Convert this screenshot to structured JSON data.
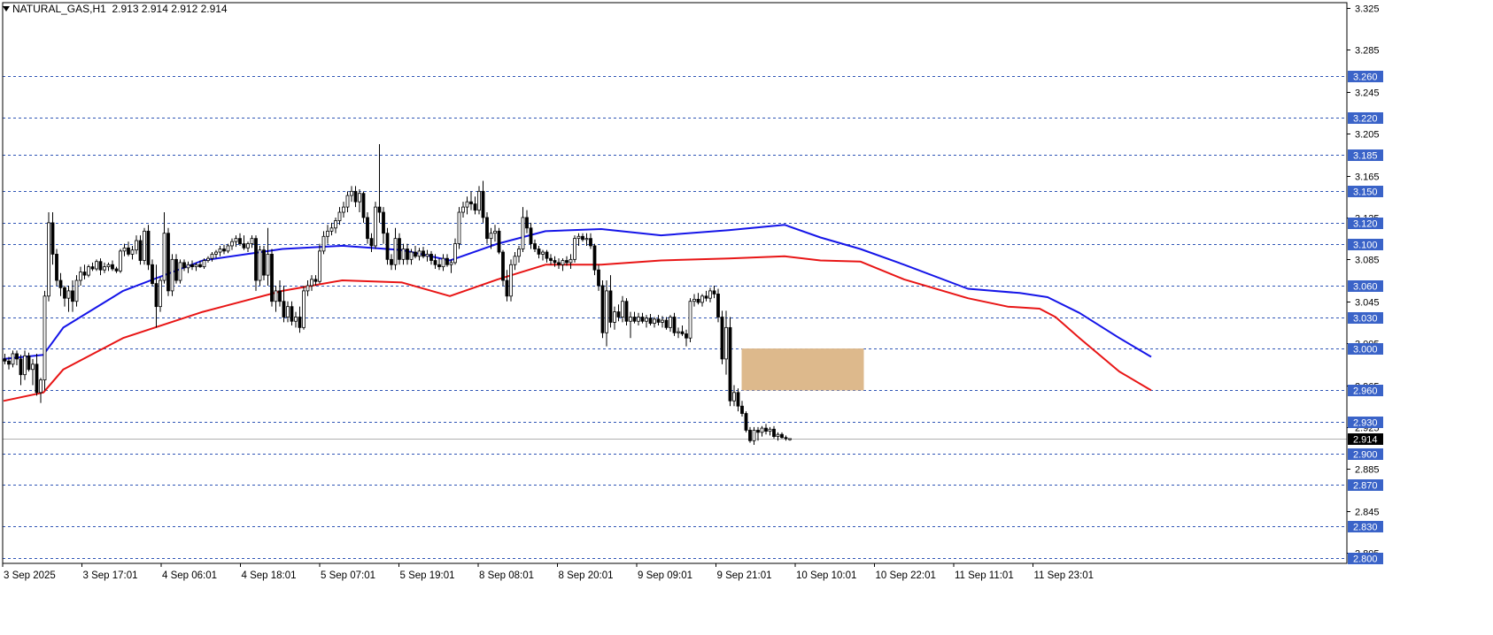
{
  "header": {
    "symbol": "NATURAL_GAS,H1",
    "ohlc": "2.913 2.914 2.912 2.914"
  },
  "colors": {
    "background": "#ffffff",
    "level_line": "#2f55b5",
    "level_label_bg": "#3a63c8",
    "ma_fast": "#1515e8",
    "ma_slow": "#e81515",
    "zone": "#ddb98c",
    "price_label_bg": "#000000",
    "candle_bull": "#ffffff",
    "candle_bear": "#000000"
  },
  "chart_data": {
    "type": "candlestick",
    "timeframe": "H1",
    "y_range": [
      2.795,
      3.327
    ],
    "y_axis_ticks": [
      3.325,
      3.285,
      3.245,
      3.205,
      3.165,
      3.125,
      3.085,
      3.045,
      3.005,
      2.965,
      2.925,
      2.885,
      2.845,
      2.805
    ],
    "x_axis_labels": [
      "3 Sep 2025",
      "3 Sep 17:01",
      "4 Sep 06:01",
      "4 Sep 18:01",
      "5 Sep 07:01",
      "5 Sep 19:01",
      "8 Sep 08:01",
      "8 Sep 20:01",
      "9 Sep 09:01",
      "9 Sep 21:01",
      "10 Sep 10:01",
      "10 Sep 22:01",
      "11 Sep 11:01",
      "11 Sep 23:01"
    ],
    "level_lines": [
      "3.260",
      "3.220",
      "3.185",
      "3.150",
      "3.120",
      "3.100",
      "3.060",
      "3.030",
      "3.000",
      "2.960",
      "2.930",
      "2.900",
      "2.870",
      "2.830",
      "2.800"
    ],
    "current_price": "2.914",
    "zone": {
      "bar_start": 185,
      "bar_end": 215,
      "price_low": 2.96,
      "price_high": 3.0
    },
    "candles": [
      [
        2.99,
        2.995,
        2.985,
        2.988
      ],
      [
        2.988,
        2.992,
        2.98,
        2.985
      ],
      [
        2.985,
        2.998,
        2.982,
        2.995
      ],
      [
        2.995,
        2.998,
        2.984,
        2.99
      ],
      [
        2.99,
        2.994,
        2.965,
        2.975
      ],
      [
        2.975,
        2.998,
        2.97,
        2.993
      ],
      [
        2.993,
        2.996,
        2.978,
        2.98
      ],
      [
        2.98,
        2.99,
        2.965,
        2.985
      ],
      [
        2.985,
        2.995,
        2.955,
        2.958
      ],
      [
        2.958,
        2.972,
        2.948,
        2.97
      ],
      [
        2.97,
        3.055,
        2.96,
        3.05
      ],
      [
        3.05,
        3.13,
        3.045,
        3.12
      ],
      [
        3.12,
        3.13,
        3.08,
        3.09
      ],
      [
        3.09,
        3.095,
        3.06,
        3.065
      ],
      [
        3.065,
        3.072,
        3.05,
        3.058
      ],
      [
        3.058,
        3.06,
        3.04,
        3.048
      ],
      [
        3.048,
        3.06,
        3.035,
        3.055
      ],
      [
        3.055,
        3.065,
        3.035,
        3.045
      ],
      [
        3.045,
        3.07,
        3.04,
        3.065
      ],
      [
        3.065,
        3.078,
        3.06,
        3.073
      ],
      [
        3.073,
        3.08,
        3.066,
        3.07
      ],
      [
        3.07,
        3.08,
        3.068,
        3.078
      ],
      [
        3.078,
        3.082,
        3.074,
        3.076
      ],
      [
        3.076,
        3.085,
        3.074,
        3.083
      ],
      [
        3.083,
        3.086,
        3.07,
        3.075
      ],
      [
        3.075,
        3.082,
        3.072,
        3.078
      ],
      [
        3.078,
        3.082,
        3.074,
        3.08
      ],
      [
        3.08,
        3.084,
        3.074,
        3.076
      ],
      [
        3.076,
        3.078,
        3.072,
        3.074
      ],
      [
        3.074,
        3.095,
        3.072,
        3.093
      ],
      [
        3.093,
        3.1,
        3.088,
        3.096
      ],
      [
        3.096,
        3.102,
        3.088,
        3.09
      ],
      [
        3.09,
        3.098,
        3.085,
        3.094
      ],
      [
        3.094,
        3.108,
        3.09,
        3.103
      ],
      [
        3.103,
        3.108,
        3.08,
        3.084
      ],
      [
        3.084,
        3.115,
        3.08,
        3.112
      ],
      [
        3.112,
        3.118,
        3.075,
        3.08
      ],
      [
        3.08,
        3.085,
        3.06,
        3.062
      ],
      [
        3.062,
        3.08,
        3.02,
        3.04
      ],
      [
        3.04,
        3.068,
        3.035,
        3.065
      ],
      [
        3.065,
        3.13,
        3.062,
        3.11
      ],
      [
        3.11,
        3.115,
        3.05,
        3.055
      ],
      [
        3.055,
        3.09,
        3.05,
        3.085
      ],
      [
        3.085,
        3.09,
        3.062,
        3.065
      ],
      [
        3.065,
        3.085,
        3.062,
        3.082
      ],
      [
        3.082,
        3.085,
        3.074,
        3.077
      ],
      [
        3.077,
        3.083,
        3.072,
        3.08
      ],
      [
        3.08,
        3.084,
        3.075,
        3.078
      ],
      [
        3.078,
        3.082,
        3.074,
        3.08
      ],
      [
        3.08,
        3.084,
        3.077,
        3.078
      ],
      [
        3.078,
        3.086,
        3.076,
        3.084
      ],
      [
        3.084,
        3.088,
        3.082,
        3.086
      ],
      [
        3.086,
        3.092,
        3.083,
        3.09
      ],
      [
        3.09,
        3.094,
        3.086,
        3.092
      ],
      [
        3.092,
        3.098,
        3.088,
        3.095
      ],
      [
        3.095,
        3.099,
        3.09,
        3.093
      ],
      [
        3.093,
        3.1,
        3.091,
        3.098
      ],
      [
        3.098,
        3.105,
        3.094,
        3.102
      ],
      [
        3.102,
        3.108,
        3.097,
        3.105
      ],
      [
        3.105,
        3.11,
        3.098,
        3.1
      ],
      [
        3.1,
        3.108,
        3.094,
        3.096
      ],
      [
        3.096,
        3.102,
        3.092,
        3.1
      ],
      [
        3.1,
        3.108,
        3.096,
        3.105
      ],
      [
        3.105,
        3.108,
        3.055,
        3.065
      ],
      [
        3.065,
        3.098,
        3.06,
        3.094
      ],
      [
        3.094,
        3.098,
        3.065,
        3.07
      ],
      [
        3.07,
        3.115,
        3.06,
        3.09
      ],
      [
        3.09,
        3.095,
        3.04,
        3.045
      ],
      [
        3.045,
        3.06,
        3.035,
        3.055
      ],
      [
        3.055,
        3.065,
        3.04,
        3.045
      ],
      [
        3.045,
        3.06,
        3.025,
        3.03
      ],
      [
        3.03,
        3.045,
        3.025,
        3.04
      ],
      [
        3.04,
        3.045,
        3.022,
        3.026
      ],
      [
        3.026,
        3.035,
        3.02,
        3.03
      ],
      [
        3.03,
        3.04,
        3.015,
        3.02
      ],
      [
        3.02,
        3.06,
        3.018,
        3.055
      ],
      [
        3.055,
        3.065,
        3.05,
        3.06
      ],
      [
        3.06,
        3.07,
        3.055,
        3.066
      ],
      [
        3.066,
        3.07,
        3.06,
        3.064
      ],
      [
        3.064,
        3.1,
        3.062,
        3.093
      ],
      [
        3.093,
        3.112,
        3.09,
        3.107
      ],
      [
        3.107,
        3.118,
        3.1,
        3.112
      ],
      [
        3.112,
        3.12,
        3.108,
        3.115
      ],
      [
        3.115,
        3.125,
        3.11,
        3.122
      ],
      [
        3.122,
        3.135,
        3.118,
        3.13
      ],
      [
        3.13,
        3.14,
        3.125,
        3.135
      ],
      [
        3.135,
        3.15,
        3.13,
        3.146
      ],
      [
        3.146,
        3.155,
        3.14,
        3.15
      ],
      [
        3.15,
        3.155,
        3.135,
        3.14
      ],
      [
        3.14,
        3.152,
        3.13,
        3.148
      ],
      [
        3.148,
        3.15,
        3.12,
        3.125
      ],
      [
        3.125,
        3.13,
        3.1,
        3.105
      ],
      [
        3.105,
        3.11,
        3.092,
        3.098
      ],
      [
        3.098,
        3.14,
        3.095,
        3.135
      ],
      [
        3.135,
        3.195,
        3.12,
        3.13
      ],
      [
        3.13,
        3.135,
        3.1,
        3.11
      ],
      [
        3.11,
        3.115,
        3.08,
        3.085
      ],
      [
        3.085,
        3.09,
        3.075,
        3.08
      ],
      [
        3.08,
        3.115,
        3.075,
        3.105
      ],
      [
        3.105,
        3.11,
        3.08,
        3.085
      ],
      [
        3.085,
        3.1,
        3.08,
        3.095
      ],
      [
        3.095,
        3.1,
        3.08,
        3.085
      ],
      [
        3.085,
        3.095,
        3.08,
        3.092
      ],
      [
        3.092,
        3.098,
        3.086,
        3.088
      ],
      [
        3.088,
        3.096,
        3.084,
        3.093
      ],
      [
        3.093,
        3.097,
        3.086,
        3.088
      ],
      [
        3.088,
        3.094,
        3.083,
        3.09
      ],
      [
        3.09,
        3.093,
        3.08,
        3.084
      ],
      [
        3.084,
        3.09,
        3.076,
        3.08
      ],
      [
        3.08,
        3.086,
        3.075,
        3.078
      ],
      [
        3.078,
        3.09,
        3.074,
        3.086
      ],
      [
        3.086,
        3.09,
        3.078,
        3.08
      ],
      [
        3.08,
        3.085,
        3.072,
        3.082
      ],
      [
        3.082,
        3.105,
        3.08,
        3.1
      ],
      [
        3.1,
        3.135,
        3.095,
        3.13
      ],
      [
        3.13,
        3.14,
        3.125,
        3.135
      ],
      [
        3.135,
        3.145,
        3.128,
        3.14
      ],
      [
        3.14,
        3.15,
        3.132,
        3.138
      ],
      [
        3.138,
        3.145,
        3.128,
        3.132
      ],
      [
        3.132,
        3.155,
        3.128,
        3.15
      ],
      [
        3.15,
        3.16,
        3.12,
        3.125
      ],
      [
        3.125,
        3.13,
        3.1,
        3.105
      ],
      [
        3.105,
        3.115,
        3.095,
        3.11
      ],
      [
        3.11,
        3.118,
        3.102,
        3.112
      ],
      [
        3.112,
        3.115,
        3.09,
        3.092
      ],
      [
        3.092,
        3.094,
        3.06,
        3.065
      ],
      [
        3.065,
        3.075,
        3.045,
        3.05
      ],
      [
        3.05,
        3.085,
        3.045,
        3.08
      ],
      [
        3.08,
        3.092,
        3.075,
        3.088
      ],
      [
        3.088,
        3.098,
        3.082,
        3.095
      ],
      [
        3.095,
        3.135,
        3.092,
        3.125
      ],
      [
        3.125,
        3.132,
        3.11,
        3.115
      ],
      [
        3.115,
        3.12,
        3.095,
        3.1
      ],
      [
        3.1,
        3.104,
        3.092,
        3.095
      ],
      [
        3.095,
        3.098,
        3.086,
        3.09
      ],
      [
        3.09,
        3.094,
        3.084,
        3.092
      ],
      [
        3.092,
        3.094,
        3.082,
        3.086
      ],
      [
        3.086,
        3.09,
        3.08,
        3.084
      ],
      [
        3.084,
        3.088,
        3.078,
        3.082
      ],
      [
        3.082,
        3.086,
        3.076,
        3.08
      ],
      [
        3.08,
        3.086,
        3.074,
        3.084
      ],
      [
        3.084,
        3.088,
        3.079,
        3.082
      ],
      [
        3.082,
        3.09,
        3.076,
        3.085
      ],
      [
        3.085,
        3.108,
        3.082,
        3.105
      ],
      [
        3.105,
        3.11,
        3.098,
        3.107
      ],
      [
        3.107,
        3.11,
        3.102,
        3.104
      ],
      [
        3.104,
        3.11,
        3.098,
        3.105
      ],
      [
        3.105,
        3.11,
        3.095,
        3.098
      ],
      [
        3.098,
        3.1,
        3.07,
        3.075
      ],
      [
        3.075,
        3.08,
        3.055,
        3.06
      ],
      [
        3.06,
        3.065,
        3.01,
        3.015
      ],
      [
        3.015,
        3.065,
        3.002,
        3.055
      ],
      [
        3.055,
        3.07,
        3.02,
        3.025
      ],
      [
        3.025,
        3.04,
        3.018,
        3.035
      ],
      [
        3.035,
        3.042,
        3.026,
        3.03
      ],
      [
        3.03,
        3.05,
        3.025,
        3.045
      ],
      [
        3.045,
        3.048,
        3.022,
        3.026
      ],
      [
        3.026,
        3.035,
        3.01,
        3.03
      ],
      [
        3.03,
        3.035,
        3.024,
        3.026
      ],
      [
        3.026,
        3.034,
        3.022,
        3.03
      ],
      [
        3.03,
        3.034,
        3.024,
        3.026
      ],
      [
        3.026,
        3.032,
        3.02,
        3.029
      ],
      [
        3.029,
        3.033,
        3.022,
        3.024
      ],
      [
        3.024,
        3.03,
        3.02,
        3.028
      ],
      [
        3.028,
        3.032,
        3.022,
        3.025
      ],
      [
        3.025,
        3.031,
        3.02,
        3.027
      ],
      [
        3.027,
        3.03,
        3.018,
        3.02
      ],
      [
        3.02,
        3.032,
        3.016,
        3.03
      ],
      [
        3.03,
        3.034,
        3.012,
        3.015
      ],
      [
        3.015,
        3.02,
        3.01,
        3.016
      ],
      [
        3.016,
        3.022,
        3.012,
        3.014
      ],
      [
        3.014,
        3.018,
        3.002,
        3.01
      ],
      [
        3.01,
        3.048,
        3.006,
        3.045
      ],
      [
        3.045,
        3.052,
        3.04,
        3.047
      ],
      [
        3.047,
        3.053,
        3.042,
        3.044
      ],
      [
        3.044,
        3.052,
        3.04,
        3.05
      ],
      [
        3.05,
        3.055,
        3.045,
        3.048
      ],
      [
        3.048,
        3.058,
        3.044,
        3.055
      ],
      [
        3.055,
        3.06,
        3.048,
        3.052
      ],
      [
        3.052,
        3.057,
        3.025,
        3.03
      ],
      [
        3.03,
        3.036,
        2.985,
        2.99
      ],
      [
        2.99,
        3.036,
        2.975,
        3.02
      ],
      [
        3.02,
        3.03,
        2.945,
        2.95
      ],
      [
        2.95,
        2.965,
        2.945,
        2.958
      ],
      [
        2.958,
        2.962,
        2.94,
        2.945
      ],
      [
        2.945,
        2.95,
        2.935,
        2.938
      ],
      [
        2.938,
        2.94,
        2.92,
        2.922
      ],
      [
        2.922,
        2.925,
        2.91,
        2.912
      ],
      [
        2.912,
        2.925,
        2.908,
        2.922
      ],
      [
        2.922,
        2.925,
        2.912,
        2.92
      ],
      [
        2.92,
        2.926,
        2.916,
        2.924
      ],
      [
        2.924,
        2.928,
        2.918,
        2.921
      ],
      [
        2.921,
        2.925,
        2.917,
        2.923
      ],
      [
        2.923,
        2.926,
        2.914,
        2.916
      ],
      [
        2.916,
        2.92,
        2.912,
        2.918
      ],
      [
        2.918,
        2.92,
        2.914,
        2.915
      ],
      [
        2.915,
        2.917,
        2.912,
        2.914
      ],
      [
        2.913,
        2.914,
        2.912,
        2.914
      ]
    ],
    "series": [
      {
        "name": "",
        "color": "#1515e8",
        "values": [
          [
            0,
            2.99
          ],
          [
            10,
            2.994
          ],
          [
            15,
            3.02
          ],
          [
            30,
            3.055
          ],
          [
            50,
            3.084
          ],
          [
            70,
            3.095
          ],
          [
            85,
            3.098
          ],
          [
            100,
            3.094
          ],
          [
            112,
            3.084
          ],
          [
            124,
            3.1
          ],
          [
            136,
            3.112
          ],
          [
            150,
            3.114
          ],
          [
            165,
            3.108
          ],
          [
            182,
            3.113
          ],
          [
            196,
            3.118
          ],
          [
            205,
            3.106
          ],
          [
            215,
            3.095
          ],
          [
            226,
            3.08
          ],
          [
            242,
            3.057
          ],
          [
            255,
            3.053
          ],
          [
            262,
            3.049
          ],
          [
            270,
            3.034
          ],
          [
            280,
            3.01
          ],
          [
            288,
            2.992
          ]
        ]
      },
      {
        "name": "",
        "color": "#e81515",
        "values": [
          [
            0,
            2.95
          ],
          [
            10,
            2.958
          ],
          [
            15,
            2.98
          ],
          [
            30,
            3.01
          ],
          [
            50,
            3.035
          ],
          [
            70,
            3.055
          ],
          [
            85,
            3.065
          ],
          [
            100,
            3.063
          ],
          [
            112,
            3.05
          ],
          [
            124,
            3.066
          ],
          [
            136,
            3.08
          ],
          [
            150,
            3.08
          ],
          [
            165,
            3.084
          ],
          [
            182,
            3.086
          ],
          [
            196,
            3.088
          ],
          [
            205,
            3.084
          ],
          [
            215,
            3.083
          ],
          [
            226,
            3.066
          ],
          [
            242,
            3.048
          ],
          [
            252,
            3.04
          ],
          [
            260,
            3.038
          ],
          [
            264,
            3.03
          ],
          [
            270,
            3.01
          ],
          [
            280,
            2.978
          ],
          [
            288,
            2.96
          ]
        ]
      }
    ]
  }
}
